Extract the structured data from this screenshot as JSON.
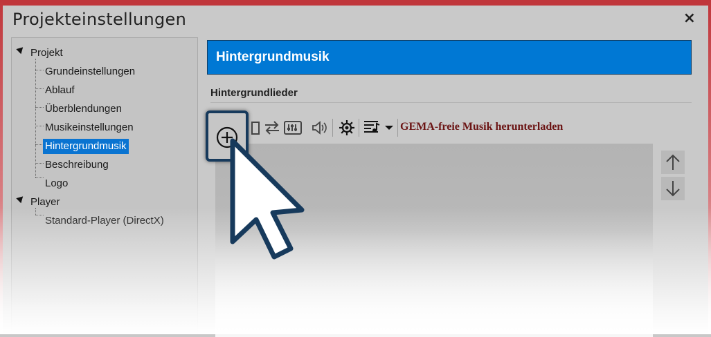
{
  "window": {
    "title": "Projekteinstellungen",
    "close_glyph": "×"
  },
  "tree": {
    "nodes": [
      {
        "label": "Projekt"
      },
      {
        "label": "Grundeinstellungen"
      },
      {
        "label": "Ablauf"
      },
      {
        "label": "Überblendungen"
      },
      {
        "label": "Musikeinstellungen"
      },
      {
        "label": "Hintergrundmusik",
        "selected": true
      },
      {
        "label": "Beschreibung"
      },
      {
        "label": "Logo"
      },
      {
        "label": "Player"
      },
      {
        "label": "Standard-Player (DirectX)"
      }
    ]
  },
  "panel": {
    "header": "Hintergrundmusik",
    "section_label": "Hintergrundlieder",
    "gema_link": "GEMA-freie Musik herunterladen"
  },
  "icons": {
    "add": "add-circle-icon",
    "delete": "delete-icon",
    "swap": "swap-arrows-icon",
    "mixer": "mixer-icon",
    "volume": "speaker-icon",
    "settings": "gear-icon",
    "music_menu": "music-list-icon",
    "move_up": "arrow-up-icon",
    "move_down": "arrow-down-icon",
    "cursor": "mouse-pointer-icon"
  },
  "colors": {
    "accent": "#0078d4",
    "frame": "#c0363b",
    "link": "#6b1414",
    "highlight_border": "#173a5c"
  }
}
